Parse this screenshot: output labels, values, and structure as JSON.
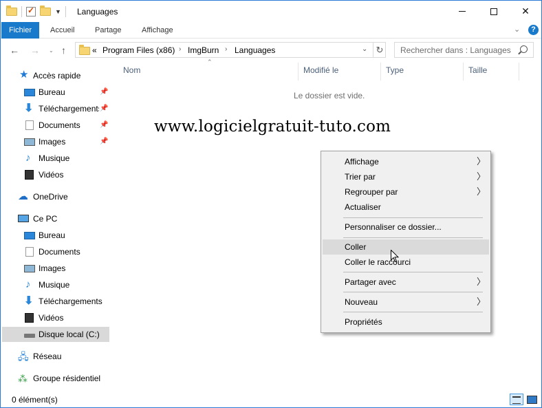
{
  "window": {
    "title": "Languages",
    "controls": {
      "minimize": "—",
      "maximize": "☐",
      "close": "✕"
    }
  },
  "ribbon": {
    "tabs": [
      "Fichier",
      "Accueil",
      "Partage",
      "Affichage"
    ],
    "help": "?"
  },
  "address": {
    "overflow": "«",
    "crumbs": [
      "Program Files (x86)",
      "ImgBurn",
      "Languages"
    ],
    "separator": "›"
  },
  "search": {
    "placeholder": "Rechercher dans : Languages"
  },
  "nav": {
    "quick_access": "Accès rapide",
    "quick_items": [
      "Bureau",
      "Téléchargements",
      "Documents",
      "Images",
      "Musique",
      "Vidéos"
    ],
    "onedrive": "OneDrive",
    "this_pc": "Ce PC",
    "pc_items": [
      "Bureau",
      "Documents",
      "Images",
      "Musique",
      "Téléchargements",
      "Vidéos",
      "Disque local (C:)"
    ],
    "network": "Réseau",
    "homegroup": "Groupe résidentiel"
  },
  "columns": [
    "Nom",
    "Modifié le",
    "Type",
    "Taille"
  ],
  "empty_message": "Le dossier est vide.",
  "watermark": "www.logicielgratuit-tuto.com",
  "context_menu": {
    "items": [
      {
        "label": "Affichage",
        "submenu": true
      },
      {
        "label": "Trier par",
        "submenu": true
      },
      {
        "label": "Regrouper par",
        "submenu": true
      },
      {
        "label": "Actualiser",
        "submenu": false
      },
      {
        "label": "Personnaliser ce dossier...",
        "submenu": false
      },
      {
        "label": "Coller",
        "submenu": false,
        "highlighted": true
      },
      {
        "label": "Coller le raccourci",
        "submenu": false
      },
      {
        "label": "Partager avec",
        "submenu": true
      },
      {
        "label": "Nouveau",
        "submenu": true
      },
      {
        "label": "Propriétés",
        "submenu": false
      }
    ]
  },
  "status": {
    "item_count": "0 élément(s)"
  },
  "colors": {
    "accent": "#1979ca",
    "selection": "#d9d9d9",
    "menu_bg": "#f0f0f0"
  }
}
